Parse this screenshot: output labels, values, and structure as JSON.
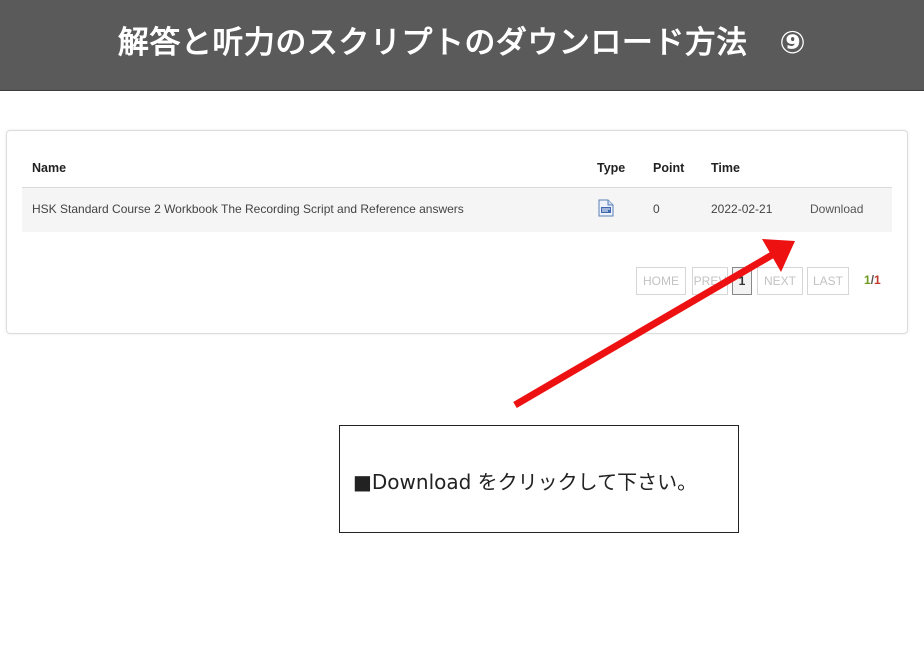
{
  "banner": {
    "title": "解答と听力のスクリプトのダウンロード方法　⑨"
  },
  "table": {
    "headers": {
      "name": "Name",
      "type": "Type",
      "point": "Point",
      "time": "Time"
    },
    "rows": [
      {
        "name": "HSK Standard Course 2 Workbook The Recording Script and Reference answers",
        "type_icon": "document-icon",
        "point": "0",
        "time": "2022-02-21",
        "action": "Download"
      }
    ]
  },
  "pagination": {
    "home": "HOME",
    "prev": "PREV",
    "current": "1",
    "next": "NEXT",
    "last": "LAST",
    "count_current": "1",
    "count_sep": "/",
    "count_total": "1"
  },
  "callout": {
    "text": "■Download をクリックして下さい。"
  },
  "colors": {
    "banner": "#5a5a5a",
    "arrow": "#ee1111",
    "page_current": "#6e9a1f",
    "page_total": "#c0392b"
  }
}
